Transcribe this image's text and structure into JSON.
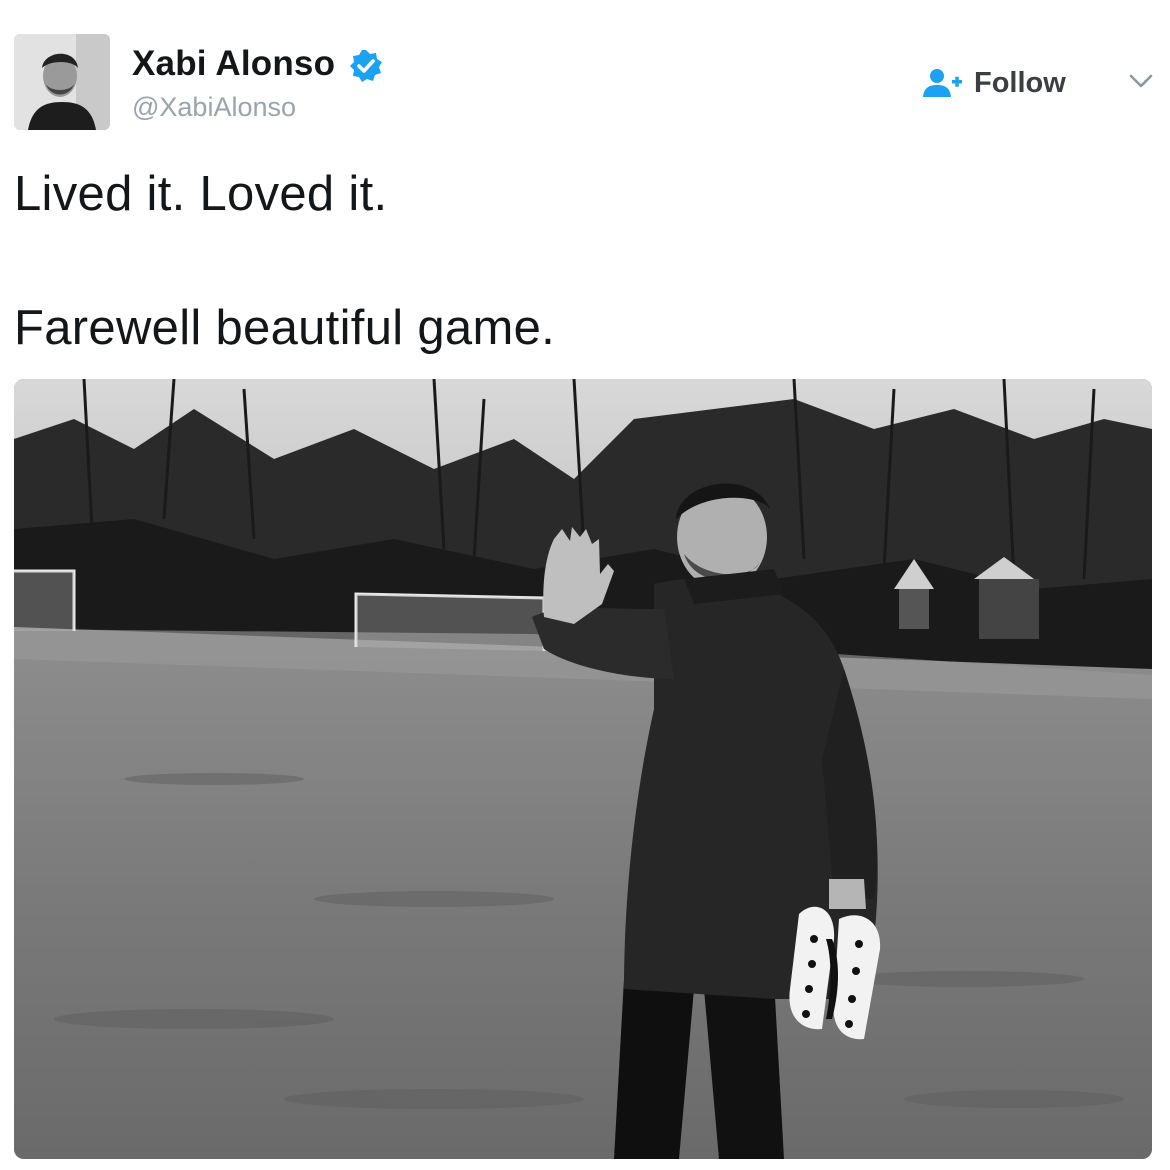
{
  "user": {
    "display_name": "Xabi Alonso",
    "handle": "@XabiAlonso",
    "verified": true
  },
  "actions": {
    "follow_label": "Follow",
    "follow_icon": "add-person-icon",
    "menu_icon": "chevron-down-icon"
  },
  "tweet": {
    "lines": [
      "Lived it. Loved it.",
      "Farewell beautiful game."
    ]
  },
  "colors": {
    "verified_badge": "#1da1f2",
    "follow_icon": "#1da1f2"
  }
}
